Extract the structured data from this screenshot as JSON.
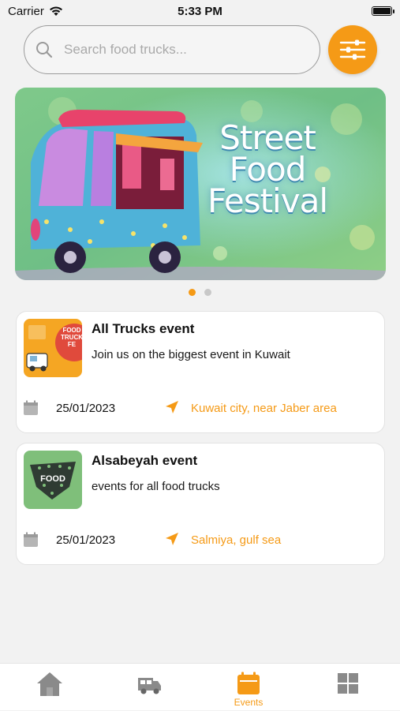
{
  "status_bar": {
    "carrier": "Carrier",
    "time": "5:33 PM",
    "icons": [
      "wifi-icon",
      "battery-icon"
    ]
  },
  "search": {
    "placeholder": "Search food trucks...",
    "value": "",
    "icon": "search-icon",
    "filter_icon": "sliders-icon"
  },
  "banner": {
    "headline_line1": "Street",
    "headline_line2": "Food",
    "headline_line3": "Festival",
    "carousel_pages": 2,
    "active_page": 1
  },
  "events": [
    {
      "title": "All Trucks event",
      "description": "Join us on the biggest event in Kuwait",
      "date": "25/01/2023",
      "location": "Kuwait city, near Jaber area",
      "thumb_text_1": "FOOD",
      "thumb_text_2": "TRUCK",
      "thumb_text_3": "FE"
    },
    {
      "title": "Alsabeyah event",
      "description": "events for all food trucks",
      "date": "25/01/2023",
      "location": "Salmiya, gulf sea",
      "thumb_text_1": "FOOD"
    }
  ],
  "tabs": [
    {
      "name": "home",
      "icon": "home-icon",
      "label": ""
    },
    {
      "name": "trucks",
      "icon": "truck-icon",
      "label": ""
    },
    {
      "name": "events",
      "icon": "calendar-icon",
      "label": "Events",
      "active": true
    },
    {
      "name": "more",
      "icon": "grid-icon",
      "label": ""
    }
  ],
  "colors": {
    "accent": "#f59a16",
    "background": "#f2f2f2",
    "inactive_icon": "#8a8a8a"
  }
}
